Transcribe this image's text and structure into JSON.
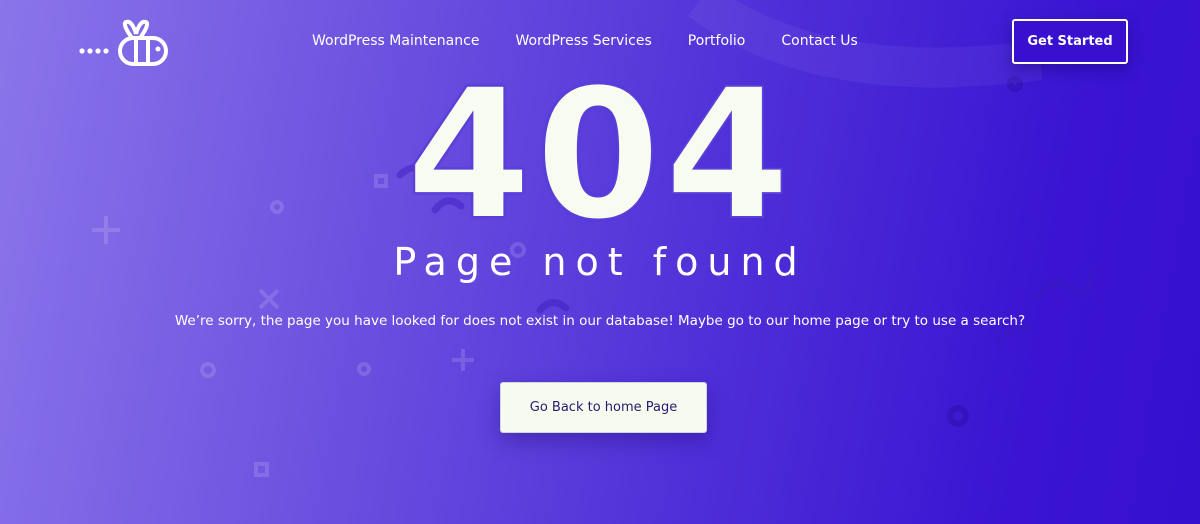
{
  "brand": {
    "logo_icon": "bee-logo-icon"
  },
  "nav": {
    "items": [
      {
        "label": "WordPress Maintenance"
      },
      {
        "label": "WordPress Services"
      },
      {
        "label": "Portfolio"
      },
      {
        "label": "Contact Us"
      }
    ],
    "cta_label": "Get Started"
  },
  "error": {
    "code": "404",
    "title": "Page not found",
    "message": "We’re sorry, the page you have looked for does not exist in our database! Maybe go to our home page or try to use a search?",
    "button_label": "Go Back to home Page"
  },
  "colors": {
    "gradient_start": "#8b75ea",
    "gradient_end": "#3610cf",
    "accent": "#3a10d0",
    "code_text": "#f8fbf0",
    "button_bg": "#f6faef",
    "button_text": "#2a1a6e"
  }
}
